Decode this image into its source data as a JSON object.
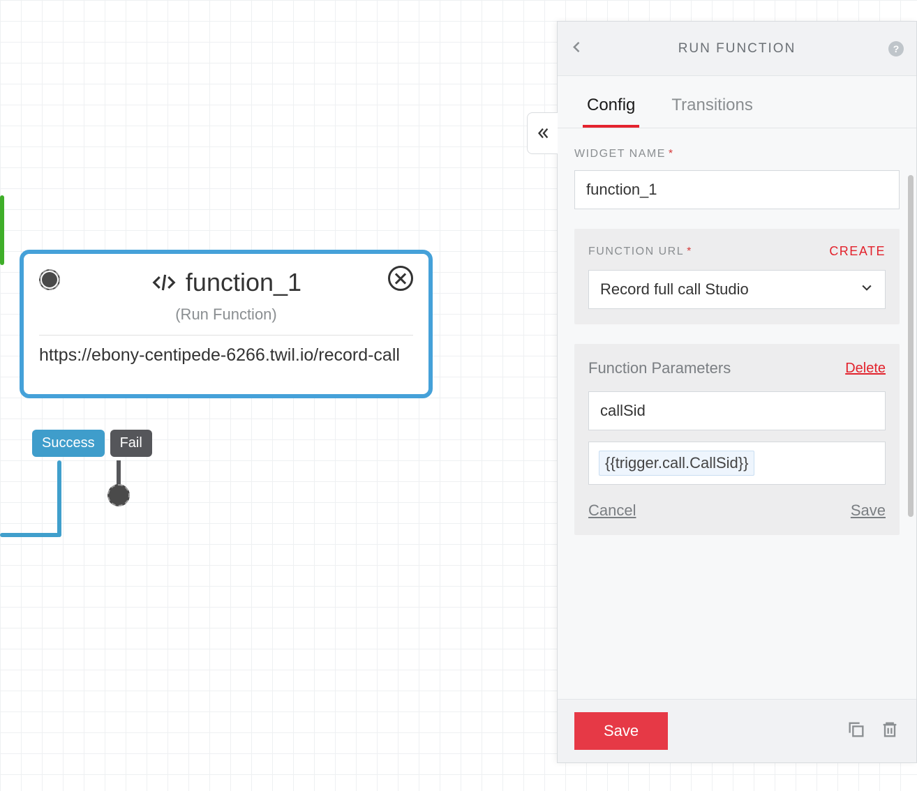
{
  "widget": {
    "title": "function_1",
    "subtitle": "(Run Function)",
    "url": "https://ebony-centipede-6266.twil.io/record-call",
    "outcomes": {
      "success": "Success",
      "fail": "Fail"
    }
  },
  "panel": {
    "title": "RUN FUNCTION",
    "tabs": {
      "config": "Config",
      "transitions": "Transitions"
    },
    "widget_name_label": "WIDGET NAME",
    "widget_name_value": "function_1",
    "function_url_label": "FUNCTION URL",
    "create_label": "CREATE",
    "function_url_value": "Record full call Studio",
    "params_title": "Function Parameters",
    "delete_label": "Delete",
    "param_key": "callSid",
    "param_value": "{{trigger.call.CallSid}}",
    "cancel_label": "Cancel",
    "save_label_sm": "Save",
    "save_button": "Save"
  }
}
